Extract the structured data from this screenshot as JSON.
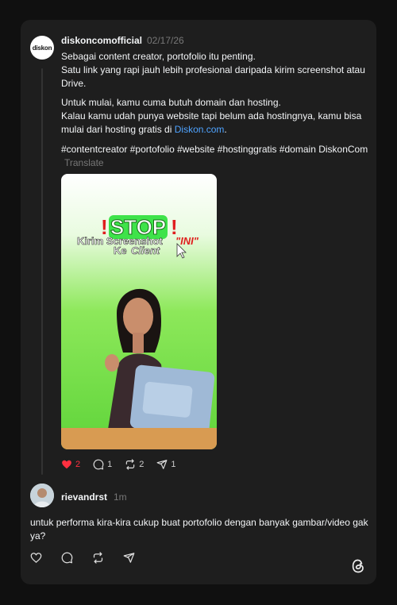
{
  "post": {
    "username": "diskoncomofficial",
    "date": "02/17/26",
    "avatar_logo": "diskon",
    "paragraph1_line1": "Sebagai content creator, portofolio itu penting.",
    "paragraph1_line2": "Satu link yang rapi jauh lebih profesional daripada kirim screenshot atau Drive.",
    "paragraph2_line1": "Untuk mulai, kamu cuma butuh domain dan hosting.",
    "paragraph2_line2_prefix": "Kalau kamu udah punya website tapi belum ada hostingnya, kamu bisa mulai dari hosting gratis di ",
    "paragraph2_link": "Diskon.com",
    "paragraph2_suffix": ".",
    "hashtags": "#contentcreator #portofolio #website #hostinggratis #domain DiskonCom",
    "translate_label": "Translate",
    "image": {
      "headline": "STOP",
      "line1": "Kirim Screenshot",
      "highlight": "\"INI\"",
      "line2_prefix": "Ke",
      "line2_emph": "Client"
    },
    "actions": {
      "likes": "2",
      "comments": "1",
      "reposts": "2",
      "shares": "1"
    }
  },
  "reply": {
    "username": "rievandrst",
    "time": "1m",
    "text": "untuk performa kira-kira cukup buat portofolio dengan banyak gambar/video gak ya?"
  },
  "colors": {
    "background": "#101010",
    "card": "#1e1e1e",
    "link": "#4fa3ff",
    "like_active": "#ff3040",
    "muted": "#777777"
  },
  "icons": [
    "heart-icon",
    "comment-icon",
    "repost-icon",
    "share-icon",
    "threads-logo-icon"
  ]
}
